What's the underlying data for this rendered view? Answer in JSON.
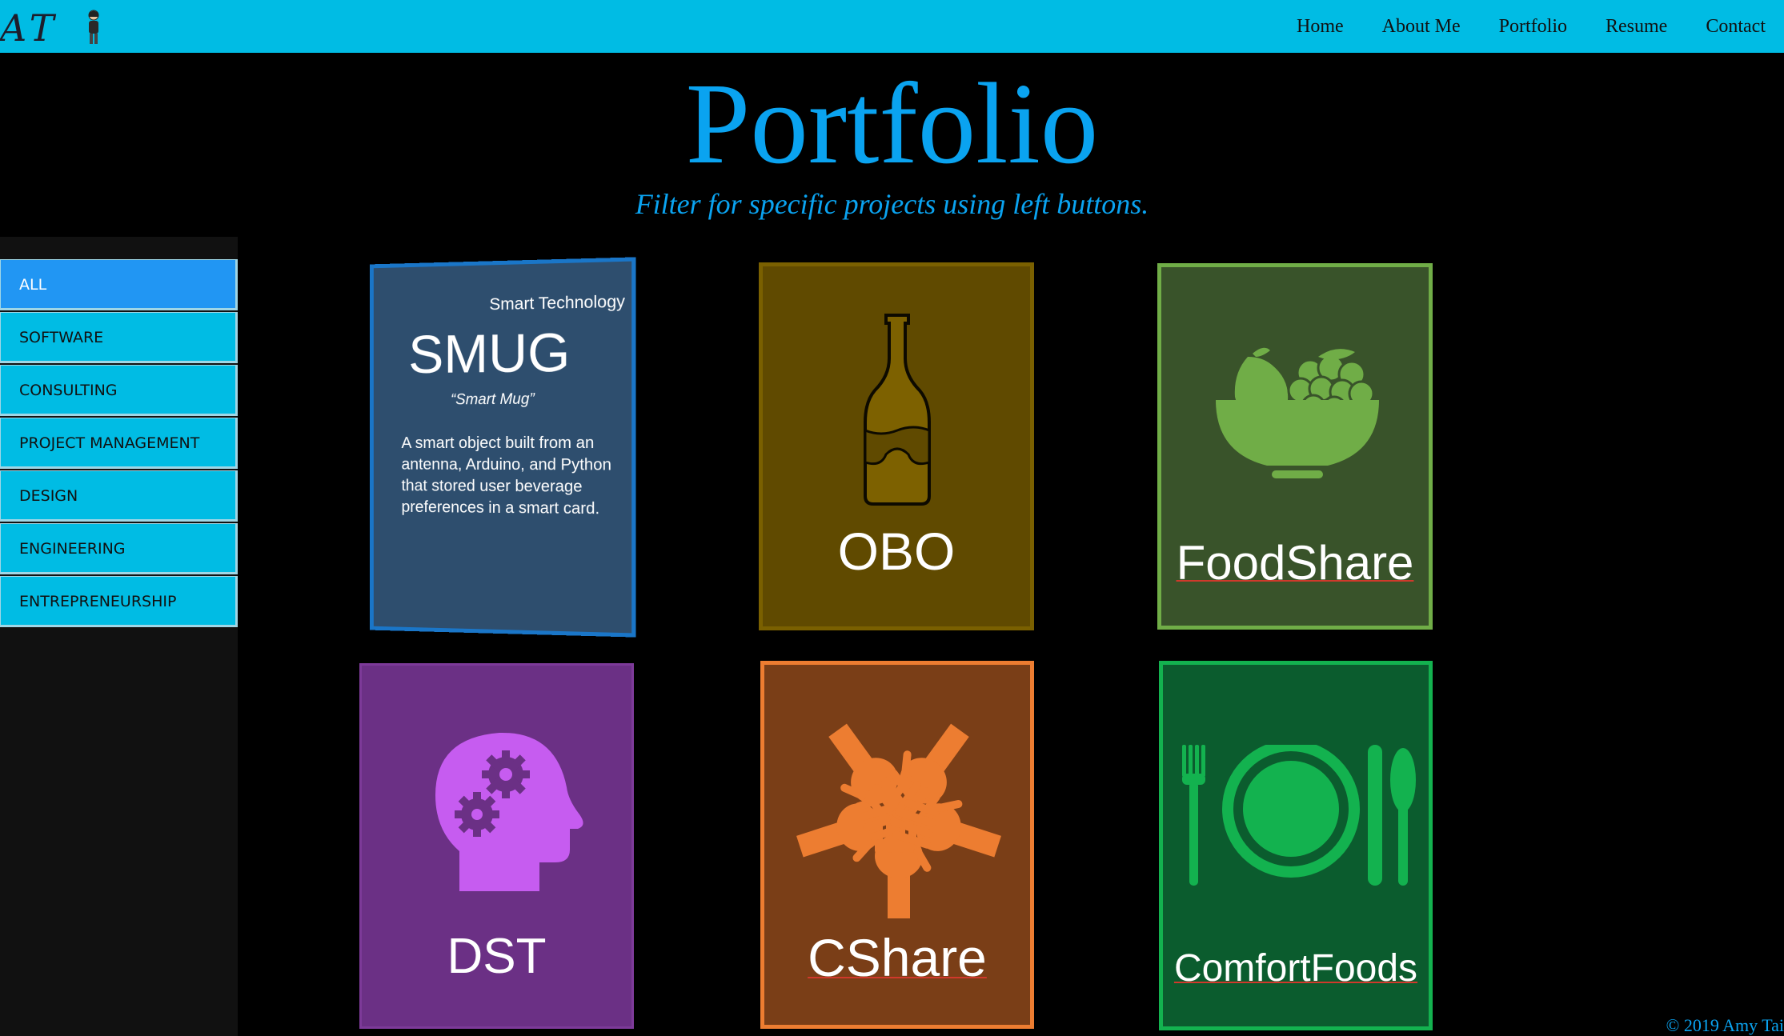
{
  "nav": {
    "logo_text": "AT",
    "links": [
      "Home",
      "About Me",
      "Portfolio",
      "Resume",
      "Contact"
    ]
  },
  "header": {
    "title": "Portfolio",
    "subtitle": "Filter for specific projects using left buttons."
  },
  "sidebar": {
    "filters": [
      "ALL",
      "SOFTWARE",
      "CONSULTING",
      "PROJECT MANAGEMENT",
      "DESIGN",
      "ENGINEERING",
      "ENTREPRENEURSHIP"
    ],
    "active": "ALL"
  },
  "projects": {
    "smug": {
      "category": "Smart Technology",
      "name": "SMUG",
      "nickname": "“Smart Mug”",
      "description": "A smart object built from an antenna, Arduino, and Python that stored user beverage preferences in a smart card.",
      "icon": "none",
      "color": "#2e4e6e"
    },
    "obo": {
      "name": "OBO",
      "icon": "bottle-icon",
      "color": "#604a00"
    },
    "foodshare": {
      "name": "FoodShare",
      "icon": "fruit-bowl-icon",
      "color": "#39532a"
    },
    "dst": {
      "name": "DST",
      "icon": "head-gears-icon",
      "color": "#6b3085"
    },
    "cshare": {
      "name": "CShare",
      "icon": "hands-circle-icon",
      "color": "#7a3e17"
    },
    "comfortfoods": {
      "name": "ComfortFoods",
      "icon": "plate-utensils-icon",
      "color": "#0b5c2e"
    }
  },
  "footer": {
    "text": "© 2019 Amy Tai"
  },
  "colors": {
    "accent": "#0aa3f0",
    "nav_bg": "#00bce4",
    "active_filter": "#2196f3"
  }
}
